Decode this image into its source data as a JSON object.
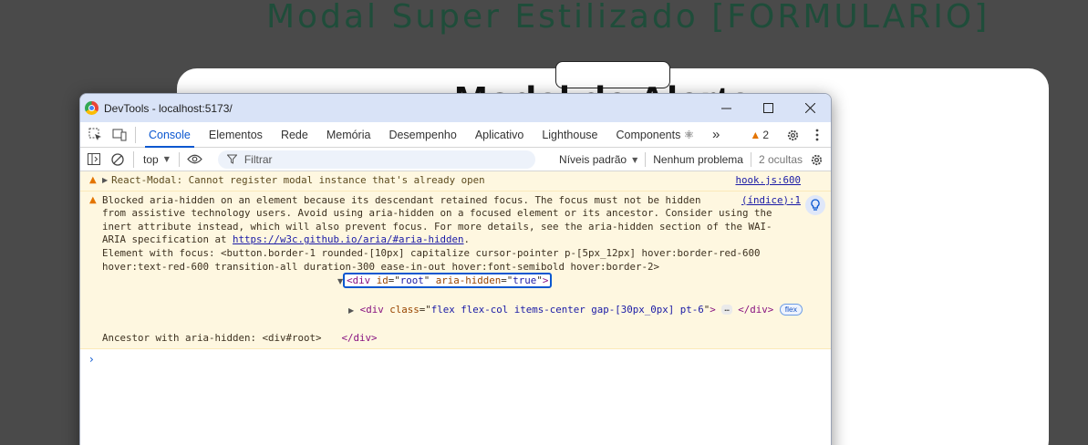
{
  "background": {
    "page_title": "Modal Super Estilizado [FORMULARIO]",
    "card_heading": "Modal de Alerta"
  },
  "devtools": {
    "window_title": "DevTools - localhost:5173/",
    "tabs": [
      {
        "label": "Console",
        "active": true
      },
      {
        "label": "Elementos"
      },
      {
        "label": "Rede"
      },
      {
        "label": "Memória"
      },
      {
        "label": "Desempenho"
      },
      {
        "label": "Aplicativo"
      },
      {
        "label": "Lighthouse"
      },
      {
        "label": "Components ⚛"
      }
    ],
    "more_tabs": "»",
    "warning_count": "2",
    "toolbar": {
      "context": "top",
      "filter_placeholder": "Filtrar",
      "levels": "Níveis padrão",
      "issues": "Nenhum problema",
      "hidden": "2 ocultas"
    },
    "messages": [
      {
        "text": "React-Modal: Cannot register modal instance that's already open",
        "source": "hook.js:600"
      },
      {
        "text_before_link": "Blocked aria-hidden on an element because its descendant retained focus. The focus must not be hidden\nfrom assistive technology users. Avoid using aria-hidden on a focused element or its ancestor. Consider using the\ninert attribute instead, which will also prevent focus. For more details, see the aria-hidden section of the WAI-\nARIA specification at ",
        "link": "https://w3c.github.io/aria/#aria-hidden",
        "text_after_link": ".",
        "focus_line": "Element with focus: <button.border-1 rounded-[10px] capitalize cursor-pointer p-[5px_12px] hover:border-red-600\nhover:text-red-600 transition-all duration-300 ease-in-out hover:font-semibold hover:border-2>",
        "source": "(índice):1",
        "root_node": {
          "tag": "div",
          "attr1": "id",
          "val1": "root",
          "attr2": "aria-hidden",
          "val2": "true"
        },
        "child_node": {
          "tag": "div",
          "attr": "class",
          "val": "flex flex-col items-center gap-[30px_0px] pt-6",
          "ellipsis": "…",
          "badge": "flex"
        },
        "ancestor_label": "Ancestor with aria-hidden: <div#root>",
        "closing_tag": "</div>"
      }
    ],
    "prompt": "›"
  }
}
